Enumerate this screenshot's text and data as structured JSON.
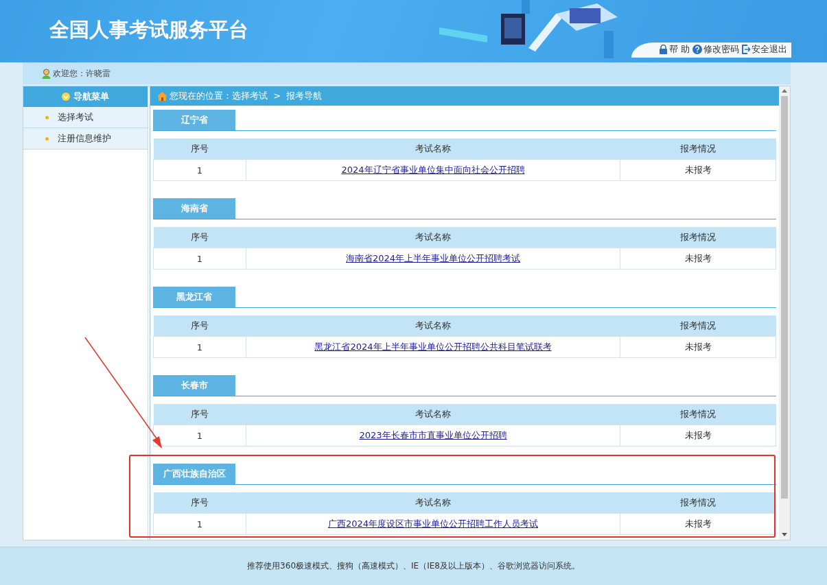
{
  "header": {
    "title": "全国人事考试服务平台",
    "links": [
      {
        "kind": "help",
        "label": "帮 助"
      },
      {
        "kind": "password",
        "label": "修改密码"
      },
      {
        "kind": "logout",
        "label": "安全退出"
      }
    ]
  },
  "welcome": {
    "label": "欢迎您：",
    "user": "许晓雷"
  },
  "sidebar": {
    "title": "导航菜单",
    "items": [
      {
        "label": "选择考试"
      },
      {
        "label": "注册信息维护"
      }
    ]
  },
  "breadcrumb": {
    "prefix": "您现在的位置：",
    "items": [
      "选择考试",
      "报考导航"
    ],
    "separator": ">"
  },
  "sections": [
    {
      "region": "辽宁省",
      "columns": [
        "序号",
        "考试名称",
        "报考情况"
      ],
      "rows": [
        [
          "1",
          "2024年辽宁省事业单位集中面向社会公开招聘",
          "未报考"
        ]
      ]
    },
    {
      "region": "海南省",
      "columns": [
        "序号",
        "考试名称",
        "报考情况"
      ],
      "rows": [
        [
          "1",
          "海南省2024年上半年事业单位公开招聘考试",
          "未报考"
        ]
      ]
    },
    {
      "region": "黑龙江省",
      "columns": [
        "序号",
        "考试名称",
        "报考情况"
      ],
      "rows": [
        [
          "1",
          "黑龙江省2024年上半年事业单位公开招聘公共科目笔试联考",
          "未报考"
        ]
      ]
    },
    {
      "region": "长春市",
      "columns": [
        "序号",
        "考试名称",
        "报考情况"
      ],
      "rows": [
        [
          "1",
          "2023年长春市市直事业单位公开招聘",
          "未报考"
        ]
      ]
    },
    {
      "region": "广西壮族自治区",
      "columns": [
        "序号",
        "考试名称",
        "报考情况"
      ],
      "rows": [
        [
          "1",
          "广西2024年度设区市事业单位公开招聘工作人员考试",
          "未报考"
        ]
      ]
    }
  ],
  "footer": "推荐使用360极速模式、搜狗（高速模式）、IE（IE8及以上版本）、谷歌浏览器访问系统。"
}
